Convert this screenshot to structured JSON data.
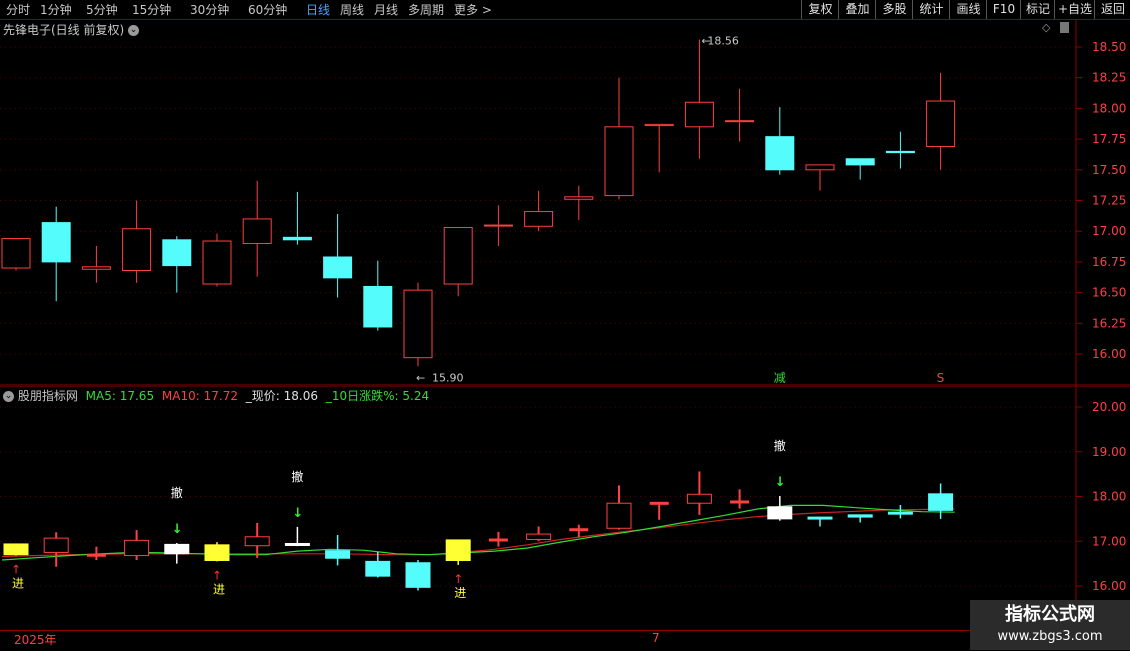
{
  "toolbar": {
    "periods": [
      {
        "label": "分时",
        "active": false
      },
      {
        "label": "1分钟",
        "active": false
      },
      {
        "label": "5分钟",
        "active": false
      },
      {
        "label": "15分钟",
        "active": false
      },
      {
        "label": "30分钟",
        "active": false
      },
      {
        "label": "60分钟",
        "active": false
      },
      {
        "label": "日线",
        "active": true
      },
      {
        "label": "周线",
        "active": false
      },
      {
        "label": "月线",
        "active": false
      },
      {
        "label": "多周期",
        "active": false
      },
      {
        "label": "更多 >",
        "active": false
      }
    ],
    "right_buttons": [
      "复权",
      "叠加",
      "多股",
      "统计",
      "画线",
      "F10",
      "标记",
      "+自选",
      "返回"
    ]
  },
  "main_chart": {
    "title": "先锋电子(日线 前复权)",
    "price_ticks": [
      "18.50",
      "18.25",
      "18.00",
      "17.75",
      "17.50",
      "17.25",
      "17.00",
      "16.75",
      "16.50",
      "16.25",
      "16.00"
    ],
    "high_label": "18.56",
    "low_label": "15.90",
    "signal_jian": "减",
    "signal_s": "S"
  },
  "indicator": {
    "name": "股朋指标网",
    "ma5_label": "MA5: 17.65",
    "ma10_label": "MA10: 17.72",
    "price_label": "_现价: 18.06",
    "change_label": "_10日涨跌%: 5.24",
    "ticks": [
      "20.00",
      "19.00",
      "18.00",
      "17.00",
      "16.00"
    ],
    "buy_label": "进",
    "sell_label": "撤"
  },
  "axis": {
    "year": "2025年",
    "month": "7"
  },
  "watermark": {
    "title": "指标公式网",
    "url": "www.zbgs3.com"
  },
  "colors": {
    "up": "#ff4040",
    "down": "#54fcfc",
    "yellow": "#ffff33",
    "white": "#ffffff",
    "ma5": "#33dd33",
    "ma10": "#cc2222",
    "grid": "#8b0000"
  },
  "chart_data": {
    "type": "candlestick",
    "title": "先锋电子(日线 前复权)",
    "ylim": [
      15.85,
      18.62
    ],
    "candles": [
      {
        "open": 16.7,
        "close": 16.94,
        "high": 16.94,
        "low": 16.68
      },
      {
        "open": 17.07,
        "close": 16.75,
        "high": 17.2,
        "low": 16.43
      },
      {
        "open": 16.69,
        "close": 16.71,
        "high": 16.88,
        "low": 16.58
      },
      {
        "open": 16.68,
        "close": 17.02,
        "high": 17.25,
        "low": 16.58
      },
      {
        "open": 16.93,
        "close": 16.72,
        "high": 16.96,
        "low": 16.5
      },
      {
        "open": 16.57,
        "close": 16.92,
        "high": 16.98,
        "low": 16.55
      },
      {
        "open": 16.9,
        "close": 17.1,
        "high": 17.41,
        "low": 16.63
      },
      {
        "open": 16.95,
        "close": 16.93,
        "high": 17.32,
        "low": 16.89
      },
      {
        "open": 16.79,
        "close": 16.62,
        "high": 17.14,
        "low": 16.46
      },
      {
        "open": 16.55,
        "close": 16.22,
        "high": 16.76,
        "low": 16.19
      },
      {
        "open": 15.97,
        "close": 16.52,
        "high": 16.58,
        "low": 15.9
      },
      {
        "open": 16.57,
        "close": 17.03,
        "high": 17.03,
        "low": 16.47
      },
      {
        "open": 17.05,
        "close": 17.05,
        "high": 17.21,
        "low": 16.88
      },
      {
        "open": 17.04,
        "close": 17.16,
        "high": 17.33,
        "low": 17.0
      },
      {
        "open": 17.26,
        "close": 17.28,
        "high": 17.37,
        "low": 17.09
      },
      {
        "open": 17.29,
        "close": 17.85,
        "high": 18.25,
        "low": 17.26
      },
      {
        "open": 17.86,
        "close": 17.87,
        "high": 17.87,
        "low": 17.48
      },
      {
        "open": 17.85,
        "close": 18.05,
        "high": 18.56,
        "low": 17.59
      },
      {
        "open": 17.9,
        "close": 17.9,
        "high": 18.16,
        "low": 17.73
      },
      {
        "open": 17.77,
        "close": 17.5,
        "high": 18.01,
        "low": 17.46
      },
      {
        "open": 17.5,
        "close": 17.54,
        "high": 17.54,
        "low": 17.33
      },
      {
        "open": 17.59,
        "close": 17.54,
        "high": 17.59,
        "low": 17.42
      },
      {
        "open": 17.65,
        "close": 17.64,
        "high": 17.81,
        "low": 17.51
      },
      {
        "open": 17.69,
        "close": 18.06,
        "high": 18.29,
        "low": 17.5
      }
    ],
    "indicator_ylim": [
      15.7,
      20.4
    ],
    "indicator_candles": [
      {
        "open": 16.7,
        "close": 16.94,
        "high": 16.94,
        "low": 16.68,
        "color": "yellow"
      },
      {
        "open": 17.07,
        "close": 16.75,
        "high": 17.2,
        "low": 16.43,
        "color": "up"
      },
      {
        "open": 16.69,
        "close": 16.71,
        "high": 16.88,
        "low": 16.58,
        "color": "up"
      },
      {
        "open": 16.68,
        "close": 17.02,
        "high": 17.25,
        "low": 16.58,
        "color": "up"
      },
      {
        "open": 16.93,
        "close": 16.72,
        "high": 16.96,
        "low": 16.5,
        "color": "white"
      },
      {
        "open": 16.57,
        "close": 16.92,
        "high": 16.98,
        "low": 16.55,
        "color": "yellow"
      },
      {
        "open": 16.9,
        "close": 17.1,
        "high": 17.41,
        "low": 16.63,
        "color": "up"
      },
      {
        "open": 16.95,
        "close": 16.93,
        "high": 17.32,
        "low": 16.89,
        "color": "white"
      },
      {
        "open": 16.79,
        "close": 16.62,
        "high": 17.14,
        "low": 16.46,
        "color": "down"
      },
      {
        "open": 16.55,
        "close": 16.22,
        "high": 16.76,
        "low": 16.19,
        "color": "down"
      },
      {
        "open": 15.97,
        "close": 16.52,
        "high": 16.58,
        "low": 15.9,
        "color": "down"
      },
      {
        "open": 16.57,
        "close": 17.03,
        "high": 17.03,
        "low": 16.47,
        "color": "yellow"
      },
      {
        "open": 17.05,
        "close": 17.05,
        "high": 17.21,
        "low": 16.88,
        "color": "up"
      },
      {
        "open": 17.04,
        "close": 17.16,
        "high": 17.33,
        "low": 17.0,
        "color": "up"
      },
      {
        "open": 17.26,
        "close": 17.28,
        "high": 17.37,
        "low": 17.09,
        "color": "up"
      },
      {
        "open": 17.29,
        "close": 17.85,
        "high": 18.25,
        "low": 17.26,
        "color": "up"
      },
      {
        "open": 17.86,
        "close": 17.87,
        "high": 17.87,
        "low": 17.48,
        "color": "up"
      },
      {
        "open": 17.85,
        "close": 18.05,
        "high": 18.56,
        "low": 17.59,
        "color": "up"
      },
      {
        "open": 17.9,
        "close": 17.9,
        "high": 18.16,
        "low": 17.73,
        "color": "up"
      },
      {
        "open": 17.77,
        "close": 17.5,
        "high": 18.01,
        "low": 17.46,
        "color": "white"
      },
      {
        "open": 17.5,
        "close": 17.54,
        "high": 17.54,
        "low": 17.33,
        "color": "down"
      },
      {
        "open": 17.59,
        "close": 17.54,
        "high": 17.59,
        "low": 17.42,
        "color": "down"
      },
      {
        "open": 17.65,
        "close": 17.64,
        "high": 17.81,
        "low": 17.51,
        "color": "down"
      },
      {
        "open": 17.69,
        "close": 18.06,
        "high": 18.29,
        "low": 17.5,
        "color": "down"
      }
    ],
    "ma5": [
      16.58,
      16.63,
      16.68,
      16.72,
      16.75,
      16.74,
      16.72,
      16.7,
      16.7,
      16.78,
      16.82,
      16.8,
      16.72,
      16.7,
      16.74,
      16.78,
      16.85,
      16.98,
      17.1,
      17.2,
      17.32,
      17.45,
      17.58,
      17.72,
      17.8,
      17.8,
      17.75,
      17.7,
      17.66,
      17.65
    ],
    "ma10": [
      16.66,
      16.68,
      16.7,
      16.71,
      16.72,
      16.72,
      16.72,
      16.72,
      16.72,
      16.72,
      16.72,
      16.71,
      16.7,
      16.7,
      16.75,
      16.82,
      16.92,
      17.04,
      17.13,
      17.22,
      17.3,
      17.39,
      17.48,
      17.55,
      17.6,
      17.64,
      17.67,
      17.7,
      17.71,
      17.72
    ],
    "buy_signals": [
      0,
      5,
      11
    ],
    "sell_signals": [
      4,
      7,
      19
    ],
    "jian_index": 19,
    "s_index": 23
  }
}
